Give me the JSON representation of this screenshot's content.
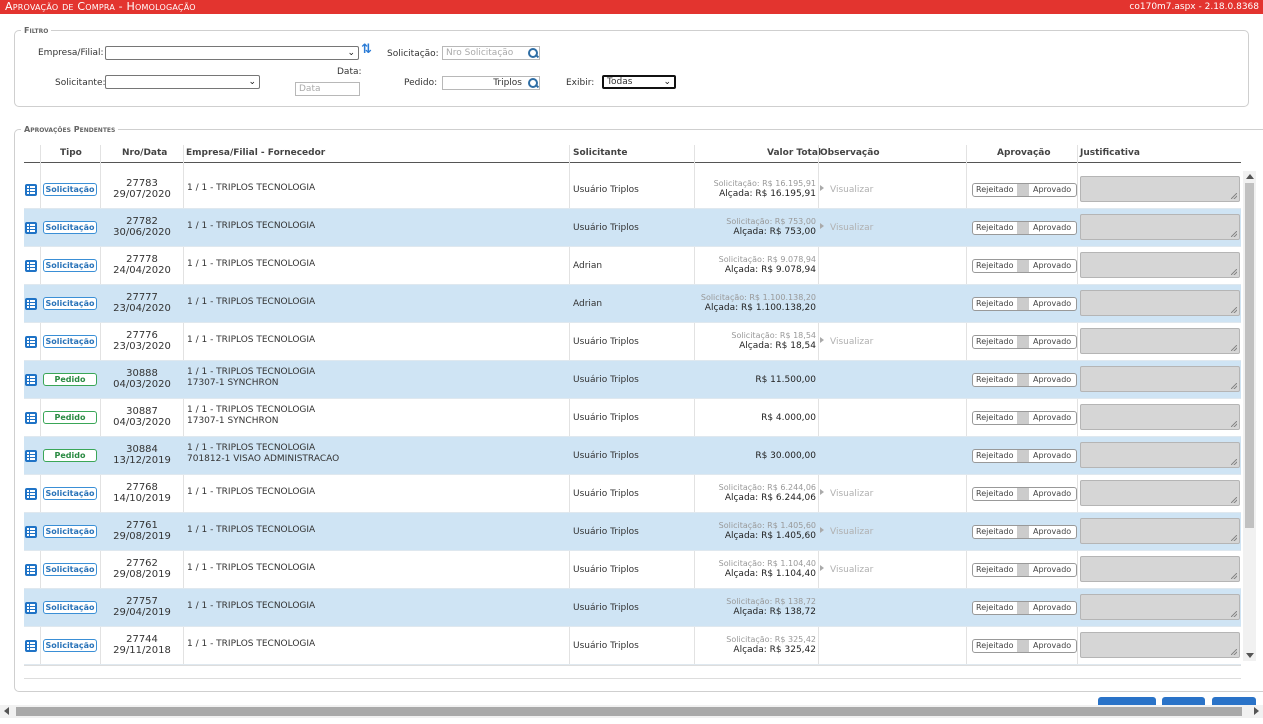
{
  "app": {
    "title": "Aprovação de Compra  - Homologação",
    "version": "co170m7.aspx - 2.18.0.8368"
  },
  "filtro": {
    "legend": "Filtro",
    "empresa_label": "Empresa/Filial:",
    "empresa_value": "",
    "solicitante_label": "Solicitante:",
    "solicitante_value": "",
    "data_label": "Data:",
    "data_placeholder": "Data",
    "solicitacao_label": "Solicitação:",
    "solicitacao_placeholder": "Nro Solicitação",
    "pedido_label": "Pedido:",
    "pedido_value": "Triplos",
    "exibir_label": "Exibir:",
    "exibir_value": "Todas"
  },
  "aprovacoes": {
    "legend": "Aprovações Pendentes",
    "columns": [
      "Tipo",
      "Nro/Data",
      "Empresa/Filial - Fornecedor",
      "Solicitante",
      "Valor Total",
      "Observação",
      "Aprovação",
      "Justificativa"
    ],
    "toggle_reject": "Rejeitado",
    "toggle_approve": "Aprovado",
    "obs_link": "Visualizar",
    "rows": [
      {
        "tipo": "Solicitação",
        "nro": "27783",
        "data": "29/07/2020",
        "empresa": "1 / 1 - TRIPLOS TECNOLOGIA",
        "fornecedor": "",
        "solicitante": "Usuário Triplos",
        "sub": "Solicitação: R$ 16.195,91",
        "valor": "Alçada: R$ 16.195,91",
        "obs": "Visualizar"
      },
      {
        "tipo": "Solicitação",
        "nro": "27782",
        "data": "30/06/2020",
        "empresa": "1 / 1 - TRIPLOS TECNOLOGIA",
        "fornecedor": "",
        "solicitante": "Usuário Triplos",
        "sub": "Solicitação: R$ 753,00",
        "valor": "Alçada: R$ 753,00",
        "obs": "Visualizar"
      },
      {
        "tipo": "Solicitação",
        "nro": "27778",
        "data": "24/04/2020",
        "empresa": "1 / 1 - TRIPLOS TECNOLOGIA",
        "fornecedor": "",
        "solicitante": "Adrian",
        "sub": "Solicitação: R$ 9.078,94",
        "valor": "Alçada: R$ 9.078,94",
        "obs": ""
      },
      {
        "tipo": "Solicitação",
        "nro": "27777",
        "data": "23/04/2020",
        "empresa": "1 / 1 - TRIPLOS TECNOLOGIA",
        "fornecedor": "",
        "solicitante": "Adrian",
        "sub": "Solicitação: R$ 1.100.138,20",
        "valor": "Alçada: R$ 1.100.138,20",
        "obs": ""
      },
      {
        "tipo": "Solicitação",
        "nro": "27776",
        "data": "23/03/2020",
        "empresa": "1 / 1 - TRIPLOS TECNOLOGIA",
        "fornecedor": "",
        "solicitante": "Usuário Triplos",
        "sub": "Solicitação: R$ 18,54",
        "valor": "Alçada: R$ 18,54",
        "obs": "Visualizar"
      },
      {
        "tipo": "Pedido",
        "nro": "30888",
        "data": "04/03/2020",
        "empresa": "1 / 1 - TRIPLOS TECNOLOGIA",
        "fornecedor": "17307-1 SYNCHRON",
        "solicitante": "Usuário Triplos",
        "sub": "",
        "valor": "R$ 11.500,00",
        "obs": ""
      },
      {
        "tipo": "Pedido",
        "nro": "30887",
        "data": "04/03/2020",
        "empresa": "1 / 1 - TRIPLOS TECNOLOGIA",
        "fornecedor": "17307-1 SYNCHRON",
        "solicitante": "Usuário Triplos",
        "sub": "",
        "valor": "R$ 4.000,00",
        "obs": ""
      },
      {
        "tipo": "Pedido",
        "nro": "30884",
        "data": "13/12/2019",
        "empresa": "1 / 1 - TRIPLOS TECNOLOGIA",
        "fornecedor": "701812-1 VISAO ADMINISTRACAO",
        "solicitante": "Usuário Triplos",
        "sub": "",
        "valor": "R$ 30.000,00",
        "obs": ""
      },
      {
        "tipo": "Solicitação",
        "nro": "27768",
        "data": "14/10/2019",
        "empresa": "1 / 1 - TRIPLOS TECNOLOGIA",
        "fornecedor": "",
        "solicitante": "Usuário Triplos",
        "sub": "Solicitação: R$ 6.244,06",
        "valor": "Alçada: R$ 6.244,06",
        "obs": "Visualizar"
      },
      {
        "tipo": "Solicitação",
        "nro": "27761",
        "data": "29/08/2019",
        "empresa": "1 / 1 - TRIPLOS TECNOLOGIA",
        "fornecedor": "",
        "solicitante": "Usuário Triplos",
        "sub": "Solicitação: R$ 1.405,60",
        "valor": "Alçada: R$ 1.405,60",
        "obs": "Visualizar"
      },
      {
        "tipo": "Solicitação",
        "nro": "27762",
        "data": "29/08/2019",
        "empresa": "1 / 1 - TRIPLOS TECNOLOGIA",
        "fornecedor": "",
        "solicitante": "Usuário Triplos",
        "sub": "Solicitação: R$ 1.104,40",
        "valor": "Alçada: R$ 1.104,40",
        "obs": "Visualizar"
      },
      {
        "tipo": "Solicitação",
        "nro": "27757",
        "data": "29/04/2019",
        "empresa": "1 / 1 - TRIPLOS TECNOLOGIA",
        "fornecedor": "",
        "solicitante": "Usuário Triplos",
        "sub": "Solicitação: R$ 138,72",
        "valor": "Alçada: R$ 138,72",
        "obs": ""
      },
      {
        "tipo": "Solicitação",
        "nro": "27744",
        "data": "29/11/2018",
        "empresa": "1 / 1 - TRIPLOS TECNOLOGIA",
        "fornecedor": "",
        "solicitante": "Usuário Triplos",
        "sub": "Solicitação: R$ 325,42",
        "valor": "Alçada: R$ 325,42",
        "obs": ""
      }
    ]
  },
  "colors": {
    "titlebar": "#e3342f",
    "row_alt": "#cfe4f4",
    "badge_solicitacao": "#3a8fd6",
    "badge_pedido": "#3aa657",
    "list_icon": "#1f73c6"
  },
  "icons": [
    "refresh-icon",
    "search-icon",
    "list-icon",
    "chevron-down-icon"
  ]
}
